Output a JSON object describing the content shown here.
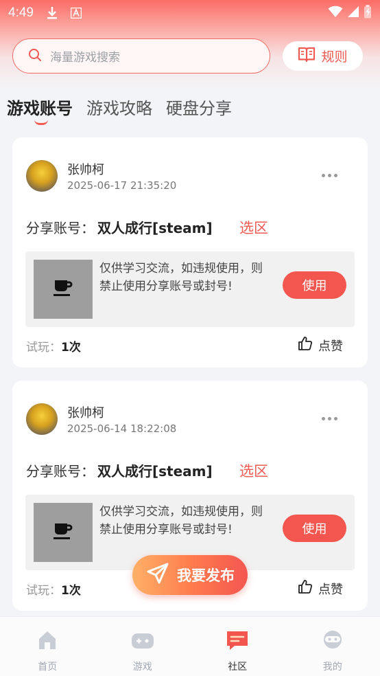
{
  "status_bar": {
    "time": "4:49"
  },
  "search": {
    "placeholder": "海量游戏搜索"
  },
  "rules_label": "规则",
  "tabs": [
    {
      "label": "游戏账号",
      "active": true
    },
    {
      "label": "游戏攻略",
      "active": false
    },
    {
      "label": "硬盘分享",
      "active": false
    }
  ],
  "posts": [
    {
      "user": "张帅柯",
      "time": "2025-06-17 21:35:20",
      "share_label": "分享账号：",
      "game": "双人成行[steam]",
      "region_link": "选区",
      "notice": "仅供学习交流，如违规使用，则禁止使用分享账号或封号!",
      "use_label": "使用",
      "trial_label": "试玩：",
      "trial_count": "1次",
      "like_label": "点赞"
    },
    {
      "user": "张帅柯",
      "time": "2025-06-14 18:22:08",
      "share_label": "分享账号：",
      "game": "双人成行[steam]",
      "region_link": "选区",
      "notice": "仅供学习交流，如违规使用，则禁止使用分享账号或封号!",
      "use_label": "使用",
      "trial_label": "试玩：",
      "trial_count": "1次",
      "like_label": "点赞"
    }
  ],
  "publish_label": "我要发布",
  "nav": [
    {
      "label": "首页",
      "icon": "home-icon",
      "active": false
    },
    {
      "label": "游戏",
      "icon": "gamepad-icon",
      "active": false
    },
    {
      "label": "社区",
      "icon": "community-icon",
      "active": true
    },
    {
      "label": "我的",
      "icon": "profile-icon",
      "active": false
    }
  ],
  "colors": {
    "accent": "#f05a52",
    "inactive": "#a0a7b3"
  }
}
